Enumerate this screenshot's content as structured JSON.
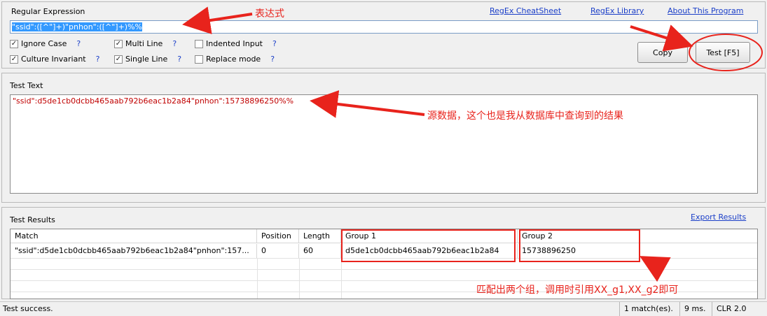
{
  "regex_panel": {
    "title": "Regular Expression",
    "links": [
      "RegEx CheatSheet",
      "RegEx Library",
      "About This Program"
    ],
    "expression": "\"ssid\":([^\"]+)\"pnhon\":([^\"]+)%%"
  },
  "options": [
    {
      "label": "Ignore Case",
      "checked": true,
      "help": "?"
    },
    {
      "label": "Multi Line",
      "checked": true,
      "help": "?"
    },
    {
      "label": "Indented Input",
      "checked": false,
      "help": "?"
    },
    {
      "label": "Culture Invariant",
      "checked": true,
      "help": "?"
    },
    {
      "label": "Single Line",
      "checked": true,
      "help": "?"
    },
    {
      "label": "Replace mode",
      "checked": false,
      "help": "?"
    }
  ],
  "buttons": {
    "copy": "Copy",
    "test": "Test [F5]"
  },
  "test_text": {
    "title": "Test Text",
    "content": "\"ssid\":d5de1cb0dcbb465aab792b6eac1b2a84\"pnhon\":15738896250%%"
  },
  "results": {
    "title": "Test Results",
    "export": "Export Results",
    "columns": [
      "Match",
      "Position",
      "Length",
      "Group 1",
      "Group 2"
    ],
    "rows": [
      [
        "\"ssid\":d5de1cb0dcbb465aab792b6eac1b2a84\"pnhon\":157...",
        "0",
        "60",
        "d5de1cb0dcbb465aab792b6eac1b2a84",
        "15738896250"
      ]
    ]
  },
  "status": {
    "message": "Test success.",
    "matches": "1 match(es).",
    "time": "9 ms.",
    "clr": "CLR 2.0"
  },
  "annotations": {
    "expression_note": "表达式",
    "source_note": "源数据，这个也是我从数据库中查询到的结果",
    "groups_note": "匹配出两个组，调用时引用XX_g1,XX_g2即可"
  },
  "annotation_color": "#e8231c"
}
